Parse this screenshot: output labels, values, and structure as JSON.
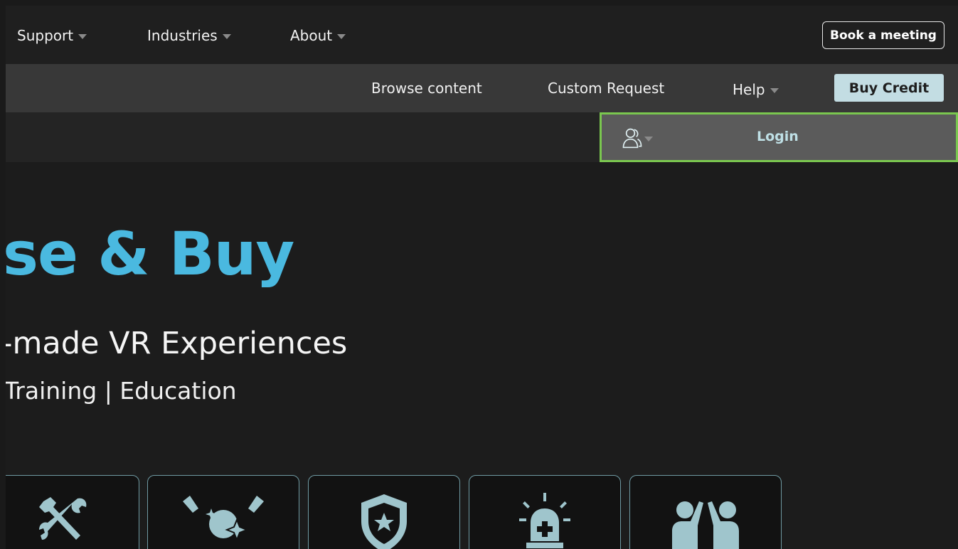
{
  "top_nav": {
    "items": [
      {
        "label": "Support"
      },
      {
        "label": "Industries"
      },
      {
        "label": "About"
      }
    ],
    "book_meeting_label": "Book a meeting"
  },
  "sub_nav": {
    "browse_label": "Browse content",
    "custom_label": "Custom Request",
    "help_label": "Help",
    "buy_credit_label": "Buy Credit"
  },
  "user_bar": {
    "login_label": "Login",
    "user_icon": "users-icon"
  },
  "hero": {
    "title": "se & Buy",
    "subtitle": "-made VR Experiences",
    "tagline": "Training | Education"
  },
  "tiles": [
    {
      "icon": "tools-icon"
    },
    {
      "icon": "spotlight-icon"
    },
    {
      "icon": "shield-star-icon"
    },
    {
      "icon": "alarm-light-icon"
    },
    {
      "icon": "people-highfive-icon"
    }
  ],
  "colors": {
    "accent_blue": "#4ab9e0",
    "button_light": "#c3dde3",
    "login_border": "#7ac74f",
    "tile_border": "#6f9aa3",
    "icon_fill": "#9fc5cc"
  }
}
